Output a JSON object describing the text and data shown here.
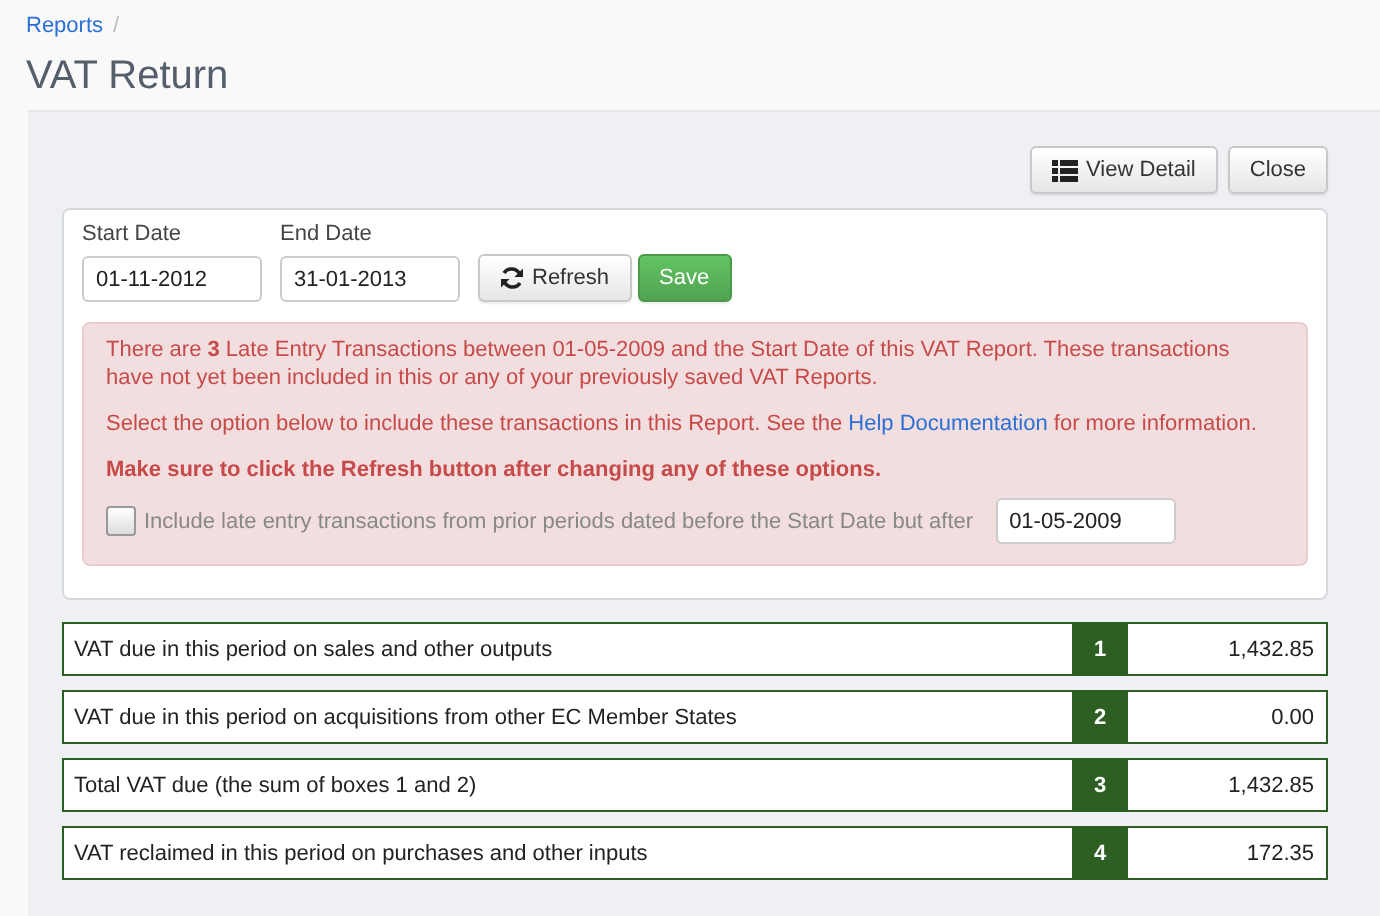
{
  "breadcrumb": {
    "items": [
      {
        "label": "Reports"
      }
    ],
    "separator": "/"
  },
  "title": "VAT Return",
  "actions": [
    {
      "label": "View Detail",
      "kind": "list"
    },
    {
      "label": "Close",
      "kind": "plain"
    }
  ],
  "filters": {
    "fields": [
      {
        "label": "Start Date",
        "value": "01-11-2012"
      },
      {
        "label": "End Date",
        "value": "31-01-2013"
      }
    ],
    "buttons": [
      {
        "label": "Refresh",
        "kind": "refresh"
      },
      {
        "label": "Save",
        "kind": "primary"
      }
    ]
  },
  "alert": {
    "message": "There are **3** Late Entry Transactions between 01-05-2009 and the Start Date of this VAT Report. These transactions have not yet been included in this or any of your previously saved VAT Reports.",
    "help": {
      "before": "Select the option below to include these transactions in this Report. See the",
      "link": "Help Documentation",
      "after": "for more information."
    },
    "warning": "Make sure to click the Refresh button after changing any of these options.",
    "option": {
      "label": "Include late entry transactions from prior periods dated before the Start Date but after",
      "checked": false,
      "date": "01-05-2009"
    }
  },
  "boxes": [
    {
      "label": "VAT due in this period on sales and other outputs",
      "number": "1",
      "value": "1,432.85"
    },
    {
      "label": "VAT due in this period on acquisitions from other EC Member States",
      "number": "2",
      "value": "0.00"
    },
    {
      "label": "Total VAT due (the sum of boxes 1 and 2)",
      "number": "3",
      "value": "1,432.85"
    },
    {
      "label": "VAT reclaimed in this period on purchases and other inputs",
      "number": "4",
      "value": "172.35"
    }
  ]
}
